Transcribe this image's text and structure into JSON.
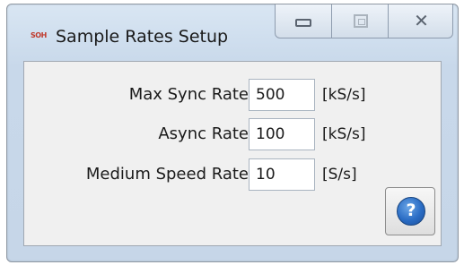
{
  "window": {
    "app_icon_text": "SOH",
    "title": "Sample Rates Setup",
    "controls": {
      "minimize_icon": "minimize-icon",
      "maximize_icon": "maximize-icon",
      "close_glyph": "✕"
    }
  },
  "form": {
    "rows": [
      {
        "label": "Max Sync Rate",
        "value": "500",
        "unit": "[kS/s]"
      },
      {
        "label": "Async Rate",
        "value": "100",
        "unit": "[kS/s]"
      },
      {
        "label": "Medium Speed Rate",
        "value": "10",
        "unit": "[S/s]"
      }
    ]
  },
  "help": {
    "glyph": "?",
    "icon": "help-icon"
  },
  "colors": {
    "title_bar": "#cfdeee",
    "client": "#f0f0f0",
    "help_blue": "#2a6cc4",
    "icon_red": "#c0392b"
  }
}
